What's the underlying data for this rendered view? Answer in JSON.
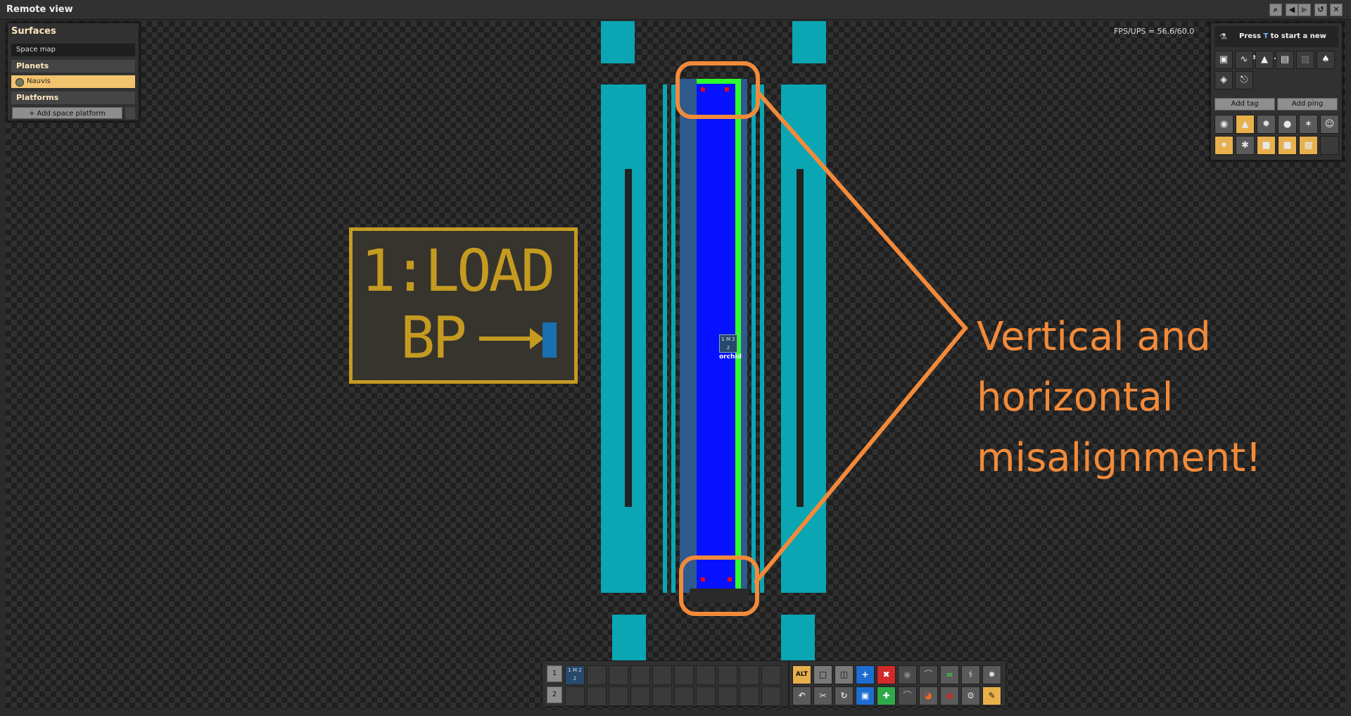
{
  "window": {
    "title": "Remote view",
    "controls": [
      "search-icon",
      "back-icon",
      "forward-icon",
      "refresh-icon",
      "close-icon"
    ]
  },
  "surfaces": {
    "title": "Surfaces",
    "space_map": "Space map",
    "planets_header": "Planets",
    "selected_planet": "Nauvis",
    "platforms_header": "Platforms",
    "add_platform": "+ Add space platform"
  },
  "fps": "FPS/UPS = 56.6/60.0",
  "research": {
    "prefix": "Press ",
    "key": "T",
    "suffix": " to start a new research."
  },
  "right_panel": {
    "add_tag": "Add tag",
    "add_ping": "Add ping"
  },
  "map": {
    "sign_line1": "1:LOAD",
    "sign_line2": "BP",
    "station_label": "orchid",
    "station_code": "1 M 2 2"
  },
  "annotation": {
    "text": "Vertical and horizontal misalignment!",
    "color": "#f28a3a"
  },
  "hotbar": {
    "row1": "1",
    "row2": "2",
    "slot1_item": "1 M 2 2"
  },
  "shortcuts": {
    "alt_label": "ALT"
  },
  "colors": {
    "rail": "#0aa6b4",
    "train": "#0511ff",
    "signal": "#2dff2d",
    "highlight": "#f28a3a",
    "sign": "#c49a21"
  }
}
